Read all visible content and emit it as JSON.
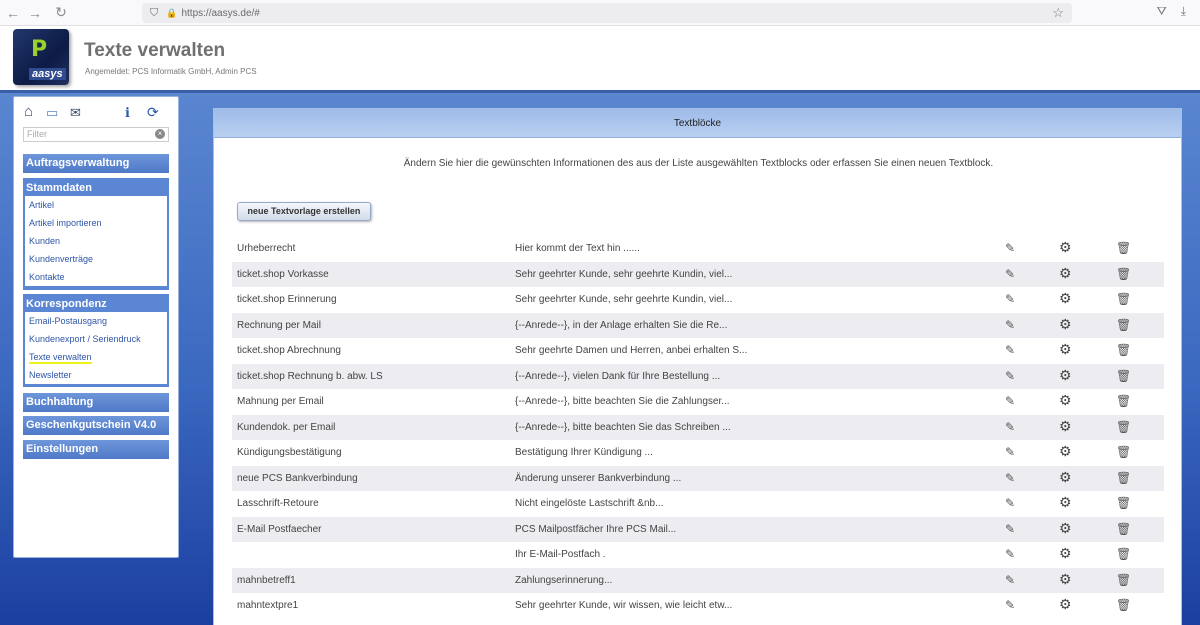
{
  "browser": {
    "url": "https://aasys.de/#",
    "back_icon": "←",
    "forward_icon": "→",
    "reload_icon": "↻",
    "shield_icon": "⛉",
    "lock_icon": "🔒",
    "star_icon": "☆",
    "pocket_icon": "⛛",
    "download_icon": "⤓"
  },
  "header": {
    "title": "Texte verwalten",
    "subtitle": "Angemeldet: PCS Informatik GmbH, Admin PCS",
    "logo_mark": "P",
    "logo_text": "aasys"
  },
  "sidebar": {
    "icons": {
      "home": "⌂",
      "folder": "▭",
      "tools": "✉",
      "info": "ℹ",
      "refresh": "⟳"
    },
    "filter_placeholder": "Filter",
    "filter_clear": "×",
    "sections": {
      "auftrag": "Auftragsverwaltung",
      "stammdaten": {
        "title": "Stammdaten",
        "items": [
          "Artikel",
          "Artikel importieren",
          "Kunden",
          "Kundenverträge",
          "Kontakte"
        ]
      },
      "korrespondenz": {
        "title": "Korrespondenz",
        "items": [
          "Email-Postausgang",
          "Kundenexport / Seriendruck",
          "Texte verwalten",
          "Newsletter"
        ]
      },
      "buchhaltung": "Buchhaltung",
      "gutschein": "Geschenkgutschein V4.0",
      "einstellungen": "Einstellungen"
    }
  },
  "main": {
    "panel_title": "Textblöcke",
    "description": "Ändern Sie hier die gewünschten Informationen des aus der Liste ausgewählten Textblocks oder erfassen Sie einen neuen Textblock.",
    "new_button": "neue Textvorlage erstellen",
    "icons": {
      "edit": "✎",
      "settings": "⚙",
      "delete": "🗑"
    },
    "rows": [
      {
        "name": "Urheberrecht",
        "text": "Hier kommt der Text hin ......"
      },
      {
        "name": "ticket.shop Vorkasse",
        "text": "Sehr geehrter Kunde, sehr geehrte Kundin, viel..."
      },
      {
        "name": "ticket.shop Erinnerung",
        "text": "Sehr geehrter Kunde, sehr geehrte Kundin, viel..."
      },
      {
        "name": "Rechnung per Mail",
        "text": "{--Anrede--}, in der Anlage erhalten Sie die Re..."
      },
      {
        "name": "ticket.shop Abrechnung",
        "text": "Sehr geehrte Damen und Herren, anbei erhalten S..."
      },
      {
        "name": "ticket.shop Rechnung b. abw. LS",
        "text": "{--Anrede--}, vielen Dank für Ihre Bestellung ..."
      },
      {
        "name": "Mahnung per Email",
        "text": "{--Anrede--}, bitte beachten Sie die Zahlungser..."
      },
      {
        "name": "Kundendok. per Email",
        "text": "{--Anrede--}, bitte beachten Sie das Schreiben ..."
      },
      {
        "name": "Kündigungsbestätigung",
        "text": "Bestätigung Ihrer Kündigung ..."
      },
      {
        "name": "neue PCS Bankverbindung",
        "text": "Änderung unserer Bankverbindung ..."
      },
      {
        "name": "Lasschrift-Retoure",
        "text": "Nicht eingelöste Lastschrift &nb..."
      },
      {
        "name": "E-Mail Postfaecher",
        "text": "PCS Mailpostfächer Ihre PCS Mail..."
      },
      {
        "name": "",
        "text": "Ihr E-Mail-Postfach ."
      },
      {
        "name": "mahnbetreff1",
        "text": "Zahlungserinnerung..."
      },
      {
        "name": "mahntextpre1",
        "text": "Sehr geehrter Kunde, wir wissen, wie leicht etw..."
      }
    ]
  }
}
